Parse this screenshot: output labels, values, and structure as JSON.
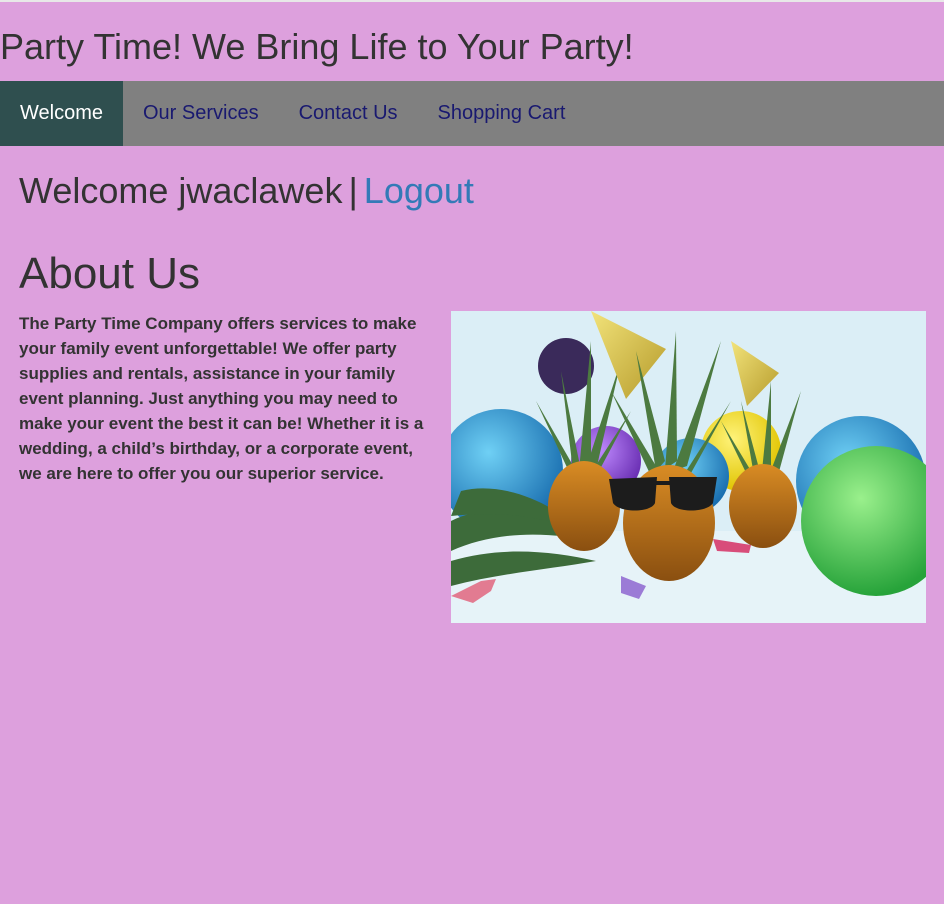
{
  "header": {
    "title": "Party Time! We Bring Life to Your Party!"
  },
  "nav": {
    "items": [
      {
        "label": "Welcome",
        "active": true
      },
      {
        "label": "Our Services",
        "active": false
      },
      {
        "label": "Contact Us",
        "active": false
      },
      {
        "label": "Shopping Cart",
        "active": false
      }
    ]
  },
  "user": {
    "greeting": "Welcome jwaclawek",
    "separator": "|",
    "logout_label": "Logout"
  },
  "about": {
    "heading": "About Us",
    "body": "The Party Time Company offers services to make your family event unforgettable! We offer party supplies and rentals, assistance in your family event planning. Just anything you may need to make your event the best it can be! Whether it is a wedding, a child’s birthday, or a corporate event, we are here to offer you our superior service."
  },
  "colors": {
    "page_background": "#dda0dd",
    "navbar_background": "#808080",
    "nav_active_background": "#2f4f4f",
    "nav_link": "#191970",
    "link": "#337ab7",
    "text": "#333333"
  }
}
